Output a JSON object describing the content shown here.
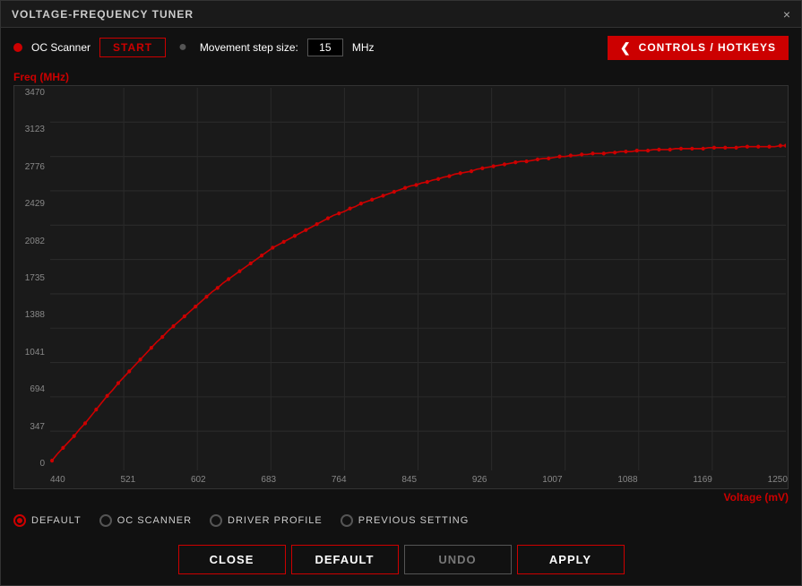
{
  "titleBar": {
    "title": "VOLTAGE-FREQUENCY TUNER",
    "closeLabel": "×"
  },
  "toolbar": {
    "ocScannerLabel": "OC Scanner",
    "startLabel": "START",
    "movementStepLabel": "Movement step size:",
    "stepValue": "15",
    "mhzLabel": "MHz",
    "controlsLabel": "CONTROLS / HOTKEYS"
  },
  "chart": {
    "yAxisLabel": "Freq (MHz)",
    "xAxisLabel": "Voltage (mV)",
    "yLabels": [
      "3470",
      "3123",
      "2776",
      "2429",
      "2082",
      "1735",
      "1388",
      "1041",
      "694",
      "347",
      "0"
    ],
    "xLabels": [
      "440",
      "521",
      "602",
      "683",
      "764",
      "845",
      "926",
      "1007",
      "1088",
      "1169",
      "1250"
    ]
  },
  "radioOptions": [
    {
      "id": "default",
      "label": "DEFAULT",
      "selected": true
    },
    {
      "id": "oc-scanner",
      "label": "OC SCANNER",
      "selected": false
    },
    {
      "id": "driver-profile",
      "label": "DRIVER PROFILE",
      "selected": false
    },
    {
      "id": "previous-setting",
      "label": "PREVIOUS SETTING",
      "selected": false
    }
  ],
  "buttons": {
    "close": "CLOSE",
    "default": "DEFAULT",
    "undo": "UNDO",
    "apply": "APPLY"
  }
}
